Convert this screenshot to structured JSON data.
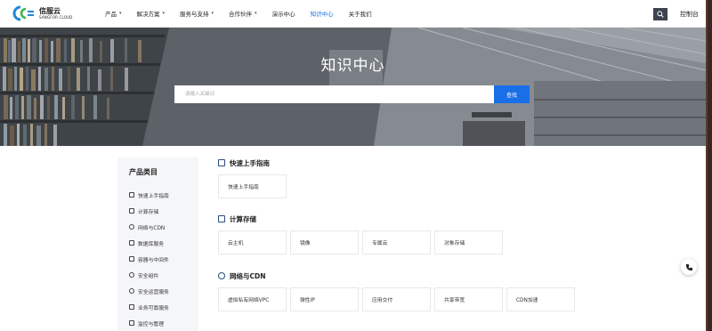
{
  "header": {
    "logo_cn": "信服云",
    "logo_en": "SANGFOR CLOUD",
    "nav": [
      {
        "label": "产品",
        "dropdown": true
      },
      {
        "label": "解决方案",
        "dropdown": true
      },
      {
        "label": "服务与支持",
        "dropdown": true
      },
      {
        "label": "合作伙伴",
        "dropdown": true
      },
      {
        "label": "演示中心",
        "dropdown": false
      },
      {
        "label": "知识中心",
        "dropdown": false,
        "active": true
      },
      {
        "label": "关于我们",
        "dropdown": false
      }
    ],
    "search_icon": "search-icon",
    "console_label": "控制台"
  },
  "banner": {
    "title": "知识中心",
    "search_placeholder": "请输入关键词",
    "search_button": "查找"
  },
  "sidebar": {
    "title": "产品类目",
    "items": [
      {
        "label": "快速上手指南",
        "icon": "guide-icon"
      },
      {
        "label": "计算存储",
        "icon": "server-icon"
      },
      {
        "label": "网络与CDN",
        "icon": "globe-icon"
      },
      {
        "label": "数据库服务",
        "icon": "database-icon"
      },
      {
        "label": "容器与中间件",
        "icon": "container-icon"
      },
      {
        "label": "安全组件",
        "icon": "shield-icon"
      },
      {
        "label": "安全运营服务",
        "icon": "shield-check-icon"
      },
      {
        "label": "业务可靠服务",
        "icon": "grid-icon"
      },
      {
        "label": "监控与管理",
        "icon": "monitor-icon"
      }
    ]
  },
  "sections": [
    {
      "title": "快速上手指南",
      "icon": "guide-icon",
      "cards": [
        "快速上手指南"
      ]
    },
    {
      "title": "计算存储",
      "icon": "server-icon",
      "cards": [
        "云主机",
        "镜像",
        "专属云",
        "对象存储"
      ]
    },
    {
      "title": "网络与CDN",
      "icon": "globe-icon",
      "cards": [
        "虚拟私有网络VPC",
        "弹性IP",
        "应用交付",
        "共享带宽",
        "CDN加速"
      ]
    }
  ],
  "colors": {
    "accent": "#1a6ee6",
    "header_search_bg": "#3d4350",
    "sidebar_bg": "#f5f6f8"
  },
  "fab_icon": "phone-icon"
}
